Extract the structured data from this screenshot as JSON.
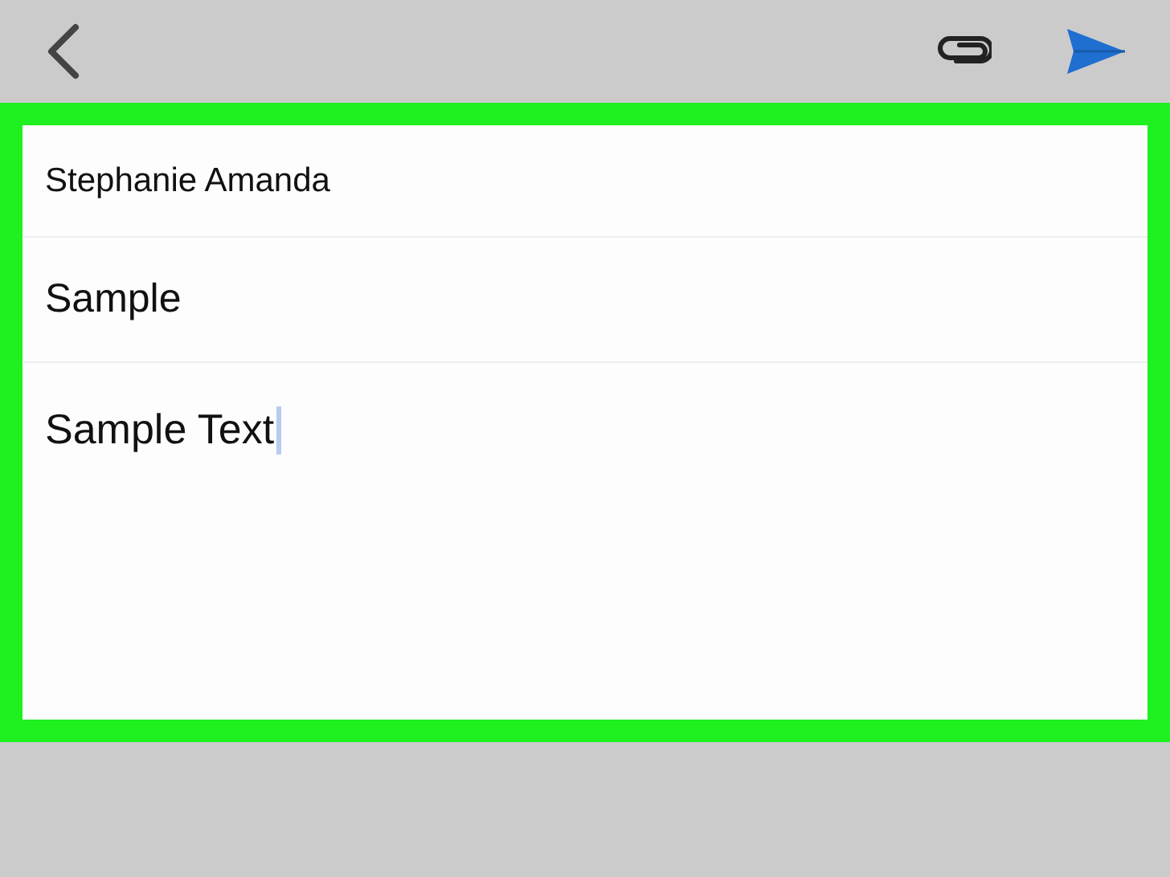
{
  "compose": {
    "recipient": "Stephanie Amanda",
    "subject": "Sample",
    "body": "Sample Text"
  }
}
